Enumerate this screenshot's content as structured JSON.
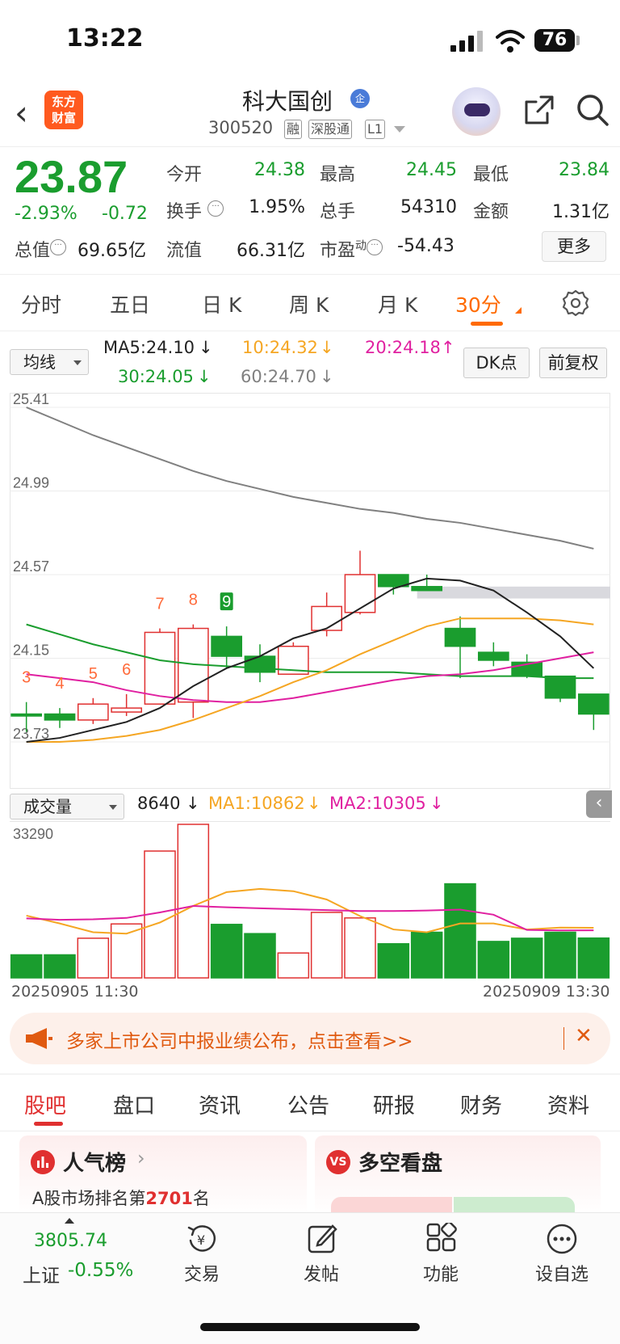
{
  "status": {
    "time": "13:22",
    "battery": "76"
  },
  "header": {
    "logo_line1": "东方",
    "logo_line2": "财富",
    "stock_name": "科大国创",
    "qi_badge": "企",
    "code": "300520",
    "tags": [
      "融",
      "深股通",
      "L1"
    ]
  },
  "quote": {
    "price": "23.87",
    "change_pct": "-2.93%",
    "change_abs": "-0.72",
    "rows": [
      [
        {
          "label": "今开",
          "value": "24.38",
          "color": "green"
        },
        {
          "label": "最高",
          "value": "24.45",
          "color": "green"
        },
        {
          "label": "最低",
          "value": "23.84",
          "color": "green"
        }
      ],
      [
        {
          "label": "换手",
          "value": "1.95%",
          "color": "black"
        },
        {
          "label": "总手",
          "value": "54310",
          "color": "black"
        },
        {
          "label": "金额",
          "value": "1.31亿",
          "color": "black"
        }
      ]
    ],
    "total_value_label": "总值",
    "total_value": "69.65亿",
    "float_label": "流值",
    "float_value": "66.31亿",
    "pe_label": "市盈",
    "pe_sup": "动",
    "pe_value": "-54.43",
    "more_label": "更多"
  },
  "tabs": [
    "分时",
    "五日",
    "日 K",
    "周 K",
    "月 K",
    "30分"
  ],
  "active_tab": "30分",
  "ma_bar": {
    "select_label": "均线",
    "ma5": "MA5:24.10",
    "ma10": "10:24.32",
    "ma20": "20:24.18",
    "ma30": "30:24.05",
    "ma60": "60:24.70",
    "dk_label": "DK点",
    "fq_label": "前复权",
    "colors": {
      "ma5": "#222222",
      "ma10": "#f5a623",
      "ma20": "#e020a0",
      "ma30": "#1a9d2e",
      "ma60": "#808080"
    }
  },
  "vol_bar": {
    "select_label": "成交量",
    "vol": "8640",
    "ma1": "MA1:10862",
    "ma2": "MA2:10305"
  },
  "chart_data": [
    {
      "type": "candlestick",
      "title": "",
      "y_ticks": [
        "25.41",
        "24.99",
        "24.57",
        "24.15",
        "23.73"
      ],
      "ylim": [
        23.73,
        25.41
      ],
      "candles": [
        {
          "o": 23.87,
          "h": 23.93,
          "l": 23.78,
          "c": 23.86
        },
        {
          "o": 23.87,
          "h": 23.9,
          "l": 23.8,
          "c": 23.84
        },
        {
          "o": 23.84,
          "h": 23.95,
          "l": 23.82,
          "c": 23.92
        },
        {
          "o": 23.88,
          "h": 23.97,
          "l": 23.86,
          "c": 23.9
        },
        {
          "o": 23.92,
          "h": 24.3,
          "l": 23.92,
          "c": 24.28
        },
        {
          "o": 23.93,
          "h": 24.32,
          "l": 23.85,
          "c": 24.3
        },
        {
          "o": 24.26,
          "h": 24.31,
          "l": 24.1,
          "c": 24.16
        },
        {
          "o": 24.16,
          "h": 24.22,
          "l": 24.03,
          "c": 24.08
        },
        {
          "o": 24.07,
          "h": 24.23,
          "l": 24.07,
          "c": 24.21
        },
        {
          "o": 24.29,
          "h": 24.48,
          "l": 24.26,
          "c": 24.41
        },
        {
          "o": 24.38,
          "h": 24.69,
          "l": 24.37,
          "c": 24.57
        },
        {
          "o": 24.57,
          "h": 24.57,
          "l": 24.47,
          "c": 24.51
        },
        {
          "o": 24.51,
          "h": 24.57,
          "l": 24.51,
          "c": 24.49
        },
        {
          "o": 24.3,
          "h": 24.36,
          "l": 24.05,
          "c": 24.21
        },
        {
          "o": 24.18,
          "h": 24.23,
          "l": 24.11,
          "c": 24.14
        },
        {
          "o": 24.13,
          "h": 24.17,
          "l": 24.05,
          "c": 24.06
        },
        {
          "o": 24.06,
          "h": 24.06,
          "l": 23.93,
          "c": 23.95
        },
        {
          "o": 23.97,
          "h": 23.97,
          "l": 23.79,
          "c": 23.87
        }
      ],
      "markers": [
        "3",
        "4",
        "5",
        "6",
        "7",
        "8",
        "9"
      ],
      "marker_candle_index": [
        0,
        1,
        2,
        3,
        4,
        5,
        6
      ],
      "ma5": [
        23.73,
        23.75,
        23.79,
        23.83,
        23.9,
        24.01,
        24.1,
        24.16,
        24.25,
        24.3,
        24.4,
        24.5,
        24.55,
        24.54,
        24.49,
        24.38,
        24.26,
        24.1
      ],
      "ma10": [
        23.73,
        23.73,
        23.74,
        23.76,
        23.79,
        23.84,
        23.9,
        23.96,
        24.03,
        24.09,
        24.17,
        24.24,
        24.31,
        24.35,
        24.35,
        24.35,
        24.34,
        24.32
      ],
      "ma20": [
        24.07,
        24.05,
        24.03,
        23.99,
        23.96,
        23.94,
        23.93,
        23.93,
        23.95,
        23.98,
        24.01,
        24.04,
        24.06,
        24.07,
        24.09,
        24.12,
        24.15,
        24.18
      ],
      "ma30": [
        24.32,
        24.27,
        24.22,
        24.18,
        24.14,
        24.12,
        24.11,
        24.1,
        24.09,
        24.08,
        24.08,
        24.08,
        24.07,
        24.06,
        24.06,
        24.06,
        24.05,
        24.05
      ],
      "ma60": [
        25.41,
        25.34,
        25.27,
        25.21,
        25.15,
        25.09,
        25.04,
        25.0,
        24.96,
        24.93,
        24.9,
        24.88,
        24.85,
        24.83,
        24.8,
        24.77,
        24.74,
        24.7
      ]
    },
    {
      "type": "bar",
      "title": "成交量",
      "y_ticks": [
        "33290"
      ],
      "ylim": [
        0,
        33290
      ],
      "values": [
        5000,
        5000,
        8600,
        11700,
        27500,
        33290,
        11600,
        9600,
        5400,
        14200,
        13000,
        7400,
        9900,
        20400,
        7900,
        8600,
        9900,
        8640
      ],
      "up": [
        false,
        false,
        true,
        true,
        true,
        true,
        false,
        false,
        true,
        true,
        true,
        false,
        false,
        false,
        false,
        false,
        false,
        false
      ],
      "ma1": [
        13500,
        11800,
        9900,
        9600,
        12000,
        15600,
        18600,
        19300,
        18800,
        17000,
        13400,
        10500,
        9900,
        11800,
        11800,
        10500,
        10900,
        10862
      ],
      "ma2": [
        12900,
        12600,
        12700,
        13000,
        14200,
        15600,
        15300,
        15100,
        14900,
        14700,
        14500,
        14500,
        14600,
        14800,
        13700,
        10400,
        10300,
        10305
      ]
    }
  ],
  "date_start": "20250905 11:30",
  "date_end": "20250909 13:30",
  "banner": {
    "text": "多家上市公司中报业绩公布，点击查看>>"
  },
  "subtabs": [
    "股吧",
    "盘口",
    "资讯",
    "公告",
    "研报",
    "财务",
    "资料"
  ],
  "active_subtab": "股吧",
  "cards": {
    "popularity_title": "人气榜",
    "rank_prefix": "A股市场排名第",
    "rank": "2701",
    "rank_suffix": "名",
    "bullbear_title": "多空看盘"
  },
  "bottom": {
    "index_value": "3805.74",
    "index_name": "上证",
    "index_change": "-0.55%",
    "nav": [
      "交易",
      "发帖",
      "功能",
      "设自选"
    ]
  },
  "colors": {
    "up": "#e03030",
    "down": "#1a9d2e",
    "accent": "#ff6a00"
  }
}
